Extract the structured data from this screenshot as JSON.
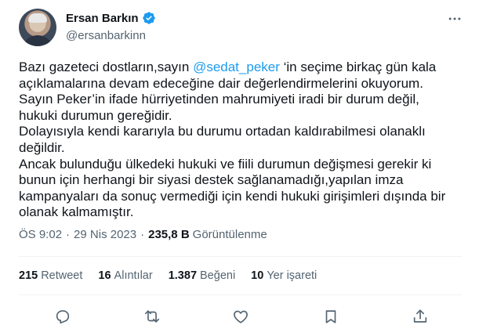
{
  "author": {
    "name": "Ersan Barkın",
    "handle": "@ersanbarkinn",
    "verified_color": "#1d9bf0"
  },
  "tweet": {
    "lines": [
      {
        "before": "Bazı gazeteci dostların,sayın ",
        "mention": "@sedat_peker",
        "after": " ‘in seçime birkaç gün kala"
      },
      {
        "text": "açıklamalarına devam edeceğine dair değerlendirmelerini okuyorum."
      },
      {
        "text": "Sayın Peker’in ifade hürriyetinden mahrumiyeti iradi bir durum değil,"
      },
      {
        "text": "hukuki durumun gereğidir."
      },
      {
        "text": "Dolayısıyla kendi kararıyla bu durumu ortadan kaldırabilmesi olanaklı"
      },
      {
        "text": "değildir."
      },
      {
        "text": "Ancak bulunduğu ülkedeki hukuki ve fiili durumun değişmesi gerekir ki"
      },
      {
        "text": "bunun için herhangi bir siyasi destek sağlanamadığı,yapılan imza"
      },
      {
        "text": "kampanyaları da sonuç vermediği için kendi hukuki girişimleri dışında bir"
      },
      {
        "text": "olanak kalmamıştır."
      }
    ]
  },
  "meta": {
    "time": "ÖS 9:02",
    "separator": "·",
    "date": "29 Nis 2023",
    "views_count": "235,8 B",
    "views_label": "Görüntülenme"
  },
  "stats": {
    "retweets": {
      "count": "215",
      "label": "Retweet"
    },
    "quotes": {
      "count": "16",
      "label": "Alıntılar"
    },
    "likes": {
      "count": "1.387",
      "label": "Beğeni"
    },
    "bookmarks": {
      "count": "10",
      "label": "Yer işareti"
    }
  },
  "icons": {
    "more": "more-icon",
    "reply": "reply-icon",
    "retweet": "retweet-icon",
    "like": "heart-icon",
    "bookmark": "bookmark-icon",
    "share": "share-icon"
  },
  "colors": {
    "text": "#0f1419",
    "muted": "#536471",
    "accent": "#1d9bf0",
    "divider": "#eff3f4"
  }
}
